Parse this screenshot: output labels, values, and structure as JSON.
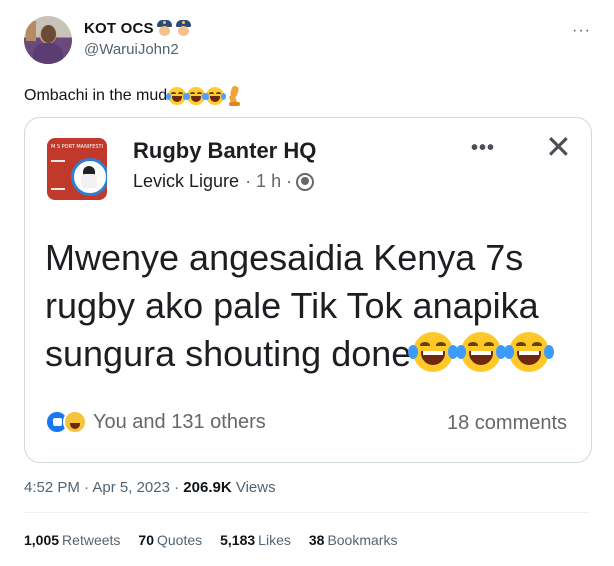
{
  "author": {
    "display_name": "KOT OCS",
    "handle": "@WaruiJohn2",
    "badges": [
      "police-officer-icon",
      "police-officer-icon"
    ]
  },
  "tweet": {
    "text": "Ombachi in the mud",
    "emojis": [
      "face-with-tears-of-joy-icon",
      "face-with-tears-of-joy-icon",
      "face-with-tears-of-joy-icon",
      "mechanical-leg-icon"
    ]
  },
  "quoted_screenshot": {
    "page_name": "Rugby Banter HQ",
    "author": "Levick Ligure",
    "meta": "· 1 h ·",
    "body": "Mwenye angesaidia Kenya 7s rugby ako pale Tik Tok anapika sungura shouting done",
    "reactions_text": "You and 131 others",
    "comments_text": "18 comments",
    "avatar_banner": "M S PORT MANIFESTO"
  },
  "footer": {
    "time": "4:52 PM",
    "date": "Apr 5, 2023",
    "views_count": "206.9K",
    "views_label": "Views",
    "stats": [
      {
        "count": "1,005",
        "label": "Retweets"
      },
      {
        "count": "70",
        "label": "Quotes"
      },
      {
        "count": "5,183",
        "label": "Likes"
      },
      {
        "count": "38",
        "label": "Bookmarks"
      }
    ]
  },
  "colors": {
    "text_primary": "#0f1419",
    "text_secondary": "#536471",
    "border": "#cfd9de",
    "fb_blue": "#1877f2"
  }
}
